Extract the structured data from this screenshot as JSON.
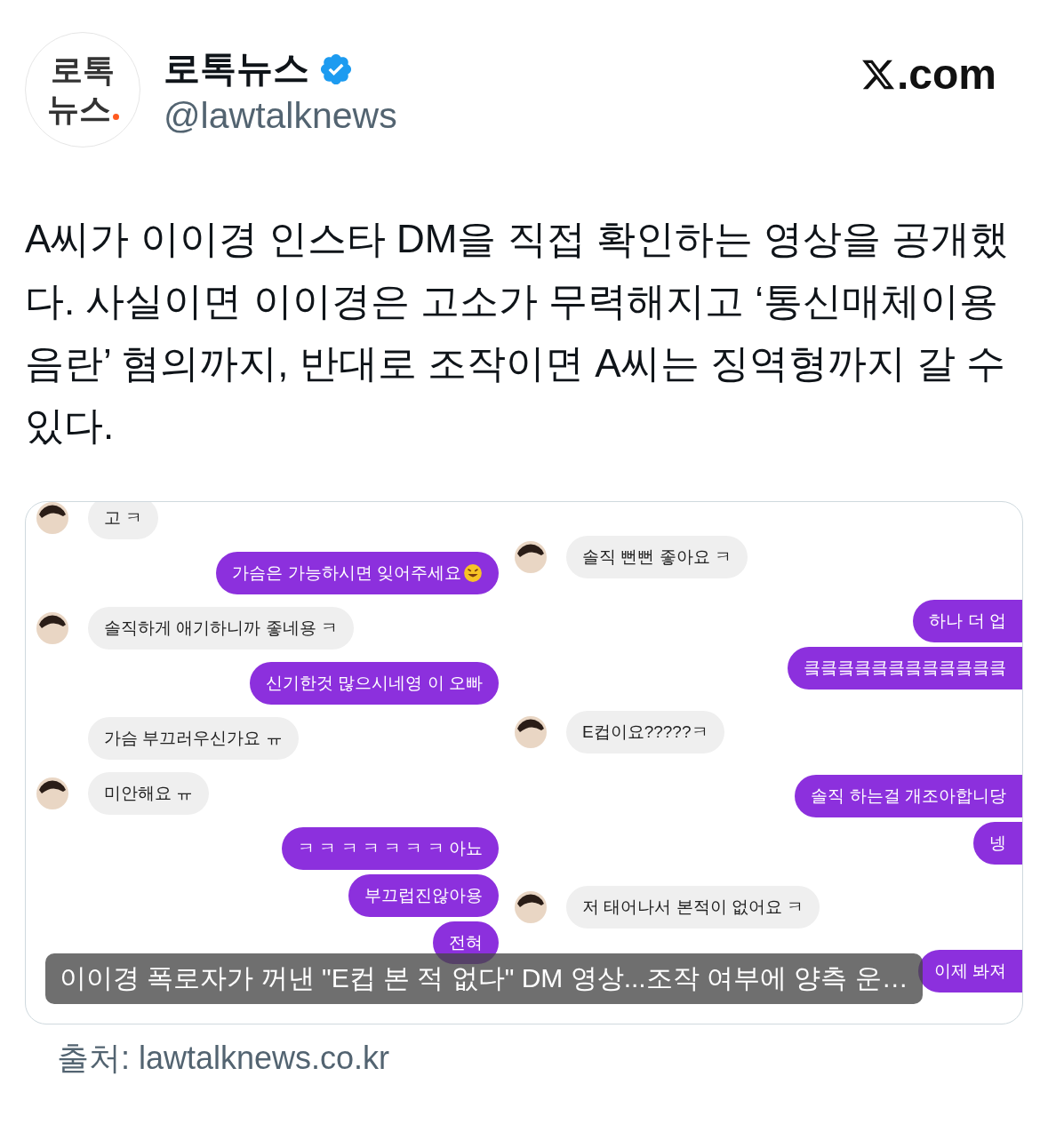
{
  "author": {
    "name": "로톡뉴스",
    "handle": "@lawtalknews",
    "verified": true,
    "avatar_lines": [
      "로톡",
      "뉴스"
    ]
  },
  "site_mark": ".com",
  "body": "A씨가 이이경 인스타 DM을 직접 확인하는 영상을 공개했다. 사실이면 이이경은 고소가 무력해지고 ‘통신매체이용음란’ 혐의까지, 반대로 조작이면 A씨는 징역형까지 갈 수 있다.",
  "card": {
    "caption": "이이경 폭로자가 꺼낸 \"E컵 본 적 없다\" DM 영상...조작 여부에 양측 운…",
    "chat_left": [
      {
        "kind": "received",
        "text": "고 ㅋ"
      },
      {
        "kind": "sent",
        "text": "가슴은 가능하시면 잊어주세요",
        "emoji": true
      },
      {
        "kind": "received",
        "text": "솔직하게 애기하니까 좋네용 ㅋ"
      },
      {
        "kind": "sent",
        "text": "신기한것 많으시네영 이 오빠"
      },
      {
        "kind": "received",
        "text": "가슴 부끄러우신가요 ㅠ",
        "avatar": false
      },
      {
        "kind": "received",
        "text": "미안해요 ㅠ"
      },
      {
        "kind": "sent",
        "text": "ㅋ ㅋ ㅋ ㅋ ㅋ ㅋ ㅋ 아뇨"
      },
      {
        "kind": "sent",
        "text": "부끄럽진않아용"
      },
      {
        "kind": "sent",
        "text": "전혀"
      }
    ],
    "chat_right": [
      {
        "kind": "received",
        "text": "솔직 뻔뻔 좋아요 ㅋ"
      },
      {
        "kind": "sent",
        "text": "하나 더 업"
      },
      {
        "kind": "sent",
        "text": "킄킄킄킄킄킄킄킄킄킄킄킄"
      },
      {
        "kind": "received",
        "text": "E컵이요?????ㅋ"
      },
      {
        "kind": "sent",
        "text": "솔직 하는걸 개조아합니당"
      },
      {
        "kind": "sent",
        "text": "넹"
      },
      {
        "kind": "received",
        "text": "저 태어나서 본적이 없어요 ㅋ"
      },
      {
        "kind": "sent",
        "text": "이제 봐져"
      }
    ]
  },
  "source": "출처: lawtalknews.co.kr"
}
